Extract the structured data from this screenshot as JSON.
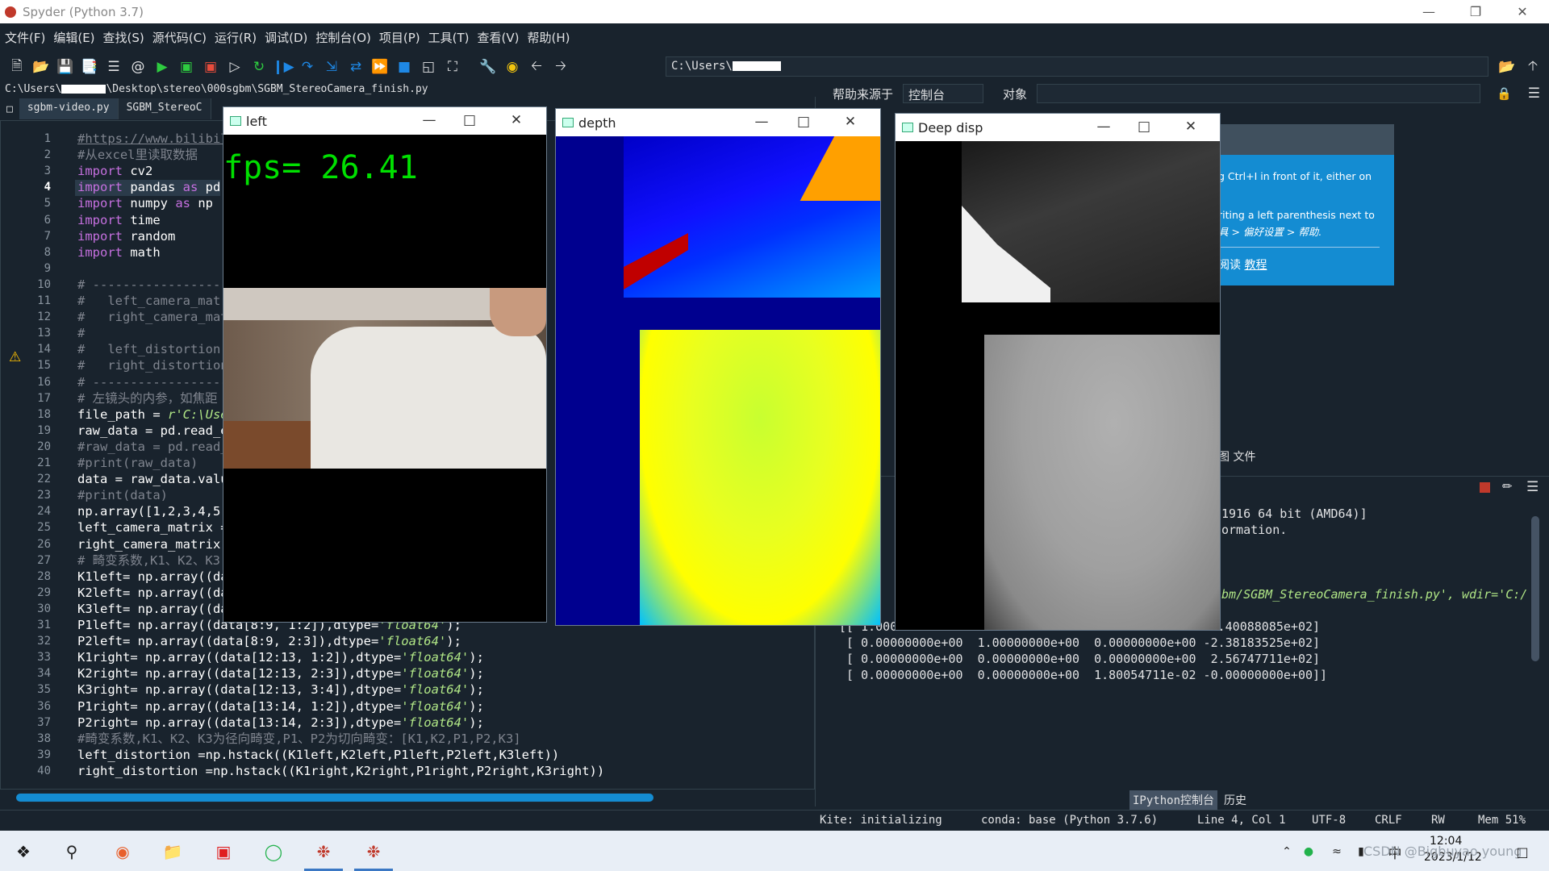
{
  "app": {
    "title": "Spyder (Python 3.7)"
  },
  "menu": [
    "文件(F)",
    "编辑(E)",
    "查找(S)",
    "源代码(C)",
    "运行(R)",
    "调试(D)",
    "控制台(O)",
    "项目(P)",
    "工具(T)",
    "查看(V)",
    "帮助(H)"
  ],
  "toolbar": {
    "path_prefix": "C:\\Users\\"
  },
  "editor": {
    "file_path_prefix": "C:\\Users\\",
    "file_path_suffix": "\\Desktop\\stereo\\000sgbm\\SGBM_StereoCamera_finish.py",
    "tabs": [
      "sgbm-video.py",
      "SGBM_StereoC"
    ],
    "current_line": 4,
    "lines": [
      {
        "n": 1,
        "html": "<span class='u'>#https://www.bilibil</span>"
      },
      {
        "n": 2,
        "html": "<span class='c'>#从excel里读取数据</span>"
      },
      {
        "n": 3,
        "html": "<span class='k'>import</span> cv2"
      },
      {
        "n": 4,
        "html": "<span class='k'>import</span> pandas <span class='k'>as</span> pd"
      },
      {
        "n": 5,
        "html": "<span class='k'>import</span> numpy <span class='k'>as</span> np"
      },
      {
        "n": 6,
        "html": "<span class='k'>import</span> time"
      },
      {
        "n": 7,
        "html": "<span class='k'>import</span> random"
      },
      {
        "n": 8,
        "html": "<span class='k'>import</span> math"
      },
      {
        "n": 9,
        "html": ""
      },
      {
        "n": 10,
        "html": "<span class='c'># ------------------</span>"
      },
      {
        "n": 11,
        "html": "<span class='c'>#   left_camera_matr</span>"
      },
      {
        "n": 12,
        "html": "<span class='c'>#   right_camera_mat</span>"
      },
      {
        "n": 13,
        "html": "<span class='c'>#</span>"
      },
      {
        "n": 14,
        "html": "<span class='c'>#   left_distortion</span>"
      },
      {
        "n": 15,
        "html": "<span class='c'>#   right_distortion</span>"
      },
      {
        "n": 16,
        "html": "<span class='c'># ------------------</span>"
      },
      {
        "n": 17,
        "html": "<span class='c'># 左镜头的内参，如焦距</span>"
      },
      {
        "n": 18,
        "html": "file_path = <span class='s'>r'C:\\Use</span>"
      },
      {
        "n": 19,
        "html": "raw_data = pd.read_e"
      },
      {
        "n": 20,
        "html": "<span class='c'>#raw_data = pd.read_</span>"
      },
      {
        "n": 21,
        "html": "<span class='c'>#print(raw_data)</span>"
      },
      {
        "n": 22,
        "html": "data = raw_data.valu"
      },
      {
        "n": 23,
        "html": "<span class='c'>#print(data)</span>"
      },
      {
        "n": 24,
        "html": "np.array([1,2,3,4,5,"
      },
      {
        "n": 25,
        "html": "left_camera_matrix ="
      },
      {
        "n": 26,
        "html": "right_camera_matrix "
      },
      {
        "n": 27,
        "html": "<span class='c'># 畸变系数,K1、K2、K3</span>"
      },
      {
        "n": 28,
        "html": "K1left= np.array((da"
      },
      {
        "n": 29,
        "html": "K2left= np.array((da"
      },
      {
        "n": 30,
        "html": "K3left= np.array((data[7:8, 3:4]),dtype=<span class='s'>'float64'</span>);"
      },
      {
        "n": 31,
        "html": "P1left= np.array((data[8:9, 1:2]),dtype=<span class='s'>'float64'</span>);"
      },
      {
        "n": 32,
        "html": "P2left= np.array((data[8:9, 2:3]),dtype=<span class='s'>'float64'</span>);"
      },
      {
        "n": 33,
        "html": "K1right= np.array((data[12:13, 1:2]),dtype=<span class='s'>'float64'</span>);"
      },
      {
        "n": 34,
        "html": "K2right= np.array((data[12:13, 2:3]),dtype=<span class='s'>'float64'</span>);"
      },
      {
        "n": 35,
        "html": "K3right= np.array((data[12:13, 3:4]),dtype=<span class='s'>'float64'</span>);"
      },
      {
        "n": 36,
        "html": "P1right= np.array((data[13:14, 1:2]),dtype=<span class='s'>'float64'</span>);"
      },
      {
        "n": 37,
        "html": "P2right= np.array((data[13:14, 2:3]),dtype=<span class='s'>'float64'</span>);"
      },
      {
        "n": 38,
        "html": "<span class='c'>#畸变系数,K1、K2、K3为径向畸变,P1、P2为切向畸变：[K1,K2,P1,P2,K3]</span>"
      },
      {
        "n": 39,
        "html": "left_distortion =np.hstack((K1left,K2left,P1left,P2left,K3left))"
      },
      {
        "n": 40,
        "html": "right_distortion =np.hstack((K1right,K2right,P1right,P2right,K3right))"
      }
    ]
  },
  "help": {
    "source_label": "帮助来源于",
    "source_value": "控制台",
    "object_label": "对象",
    "tip_line1": "g Ctrl+I in front of it, either on",
    "tip_line2": "riting a left parenthesis next to",
    "tip_line3": "具 > 偏好设置 > 帮助.",
    "tip_read": "阅读",
    "tip_link": "教程",
    "pane_tabs": "图  文件"
  },
  "console": {
    "lines_right": [
      "1916 64 bit (AMD64)]",
      "ormation.",
      "bm/SGBM_StereoCamera_finish.py', wdir='C:/"
    ],
    "matrix": [
      "[[ 1.00000000e+00  1.00000000e+00  0.00000000e+00 -3.40088085e+02]",
      " [ 0.00000000e+00  1.00000000e+00  0.00000000e+00 -2.38183525e+02]",
      " [ 0.00000000e+00  0.00000000e+00  0.00000000e+00  2.56747711e+02]",
      " [ 0.00000000e+00  0.00000000e+00  1.80054711e-02 -0.00000000e+00]]"
    ],
    "tabs": [
      "IPython控制台",
      "历史"
    ]
  },
  "windows": {
    "left": {
      "title": "left",
      "fps_text": "fps=  26.41"
    },
    "depth": {
      "title": "depth"
    },
    "disp": {
      "title": "Deep disp"
    }
  },
  "status": {
    "kite": "Kite: initializing",
    "conda": "conda: base (Python 3.7.6)",
    "position": "Line 4, Col 1",
    "encoding": "UTF-8",
    "eol": "CRLF",
    "rw": "RW",
    "mem": "Mem 51%"
  },
  "taskbar": {
    "time": "12:04",
    "date": "2023/1/12",
    "ime": "中",
    "watermark": "CSDN @Bigbuyao young"
  }
}
